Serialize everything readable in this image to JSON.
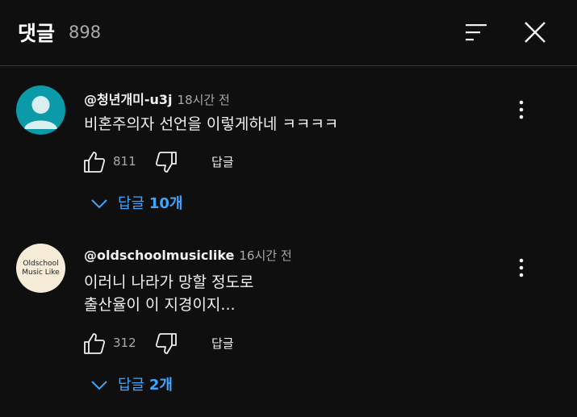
{
  "header": {
    "title": "댓글",
    "count": "898",
    "sort_icon": "sort-icon",
    "close_icon": "close-icon"
  },
  "comments": [
    {
      "author": "@청년개미-u3j",
      "time": "18시간 전",
      "text": "비혼주의자 선언을 이렇게하네 ㅋㅋㅋㅋ",
      "likes": "811",
      "reply_label": "답글",
      "replies_label": "답글",
      "replies_count": "10개",
      "avatar_color": "#0a9aa8"
    },
    {
      "author": "@oldschoolmusiclike",
      "time": "16시간 전",
      "text": "이러니 나라가 망할 정도로\n출산율이 이 지경이지...",
      "likes": "312",
      "reply_label": "답글",
      "replies_label": "답글",
      "replies_count": "2개",
      "avatar_text": "Oldschool Music Like",
      "avatar_color": "#f7ecd7"
    }
  ],
  "colors": {
    "background": "#0f0f0f",
    "link": "#3ea6ff",
    "secondary_text": "#aaaaaa"
  }
}
